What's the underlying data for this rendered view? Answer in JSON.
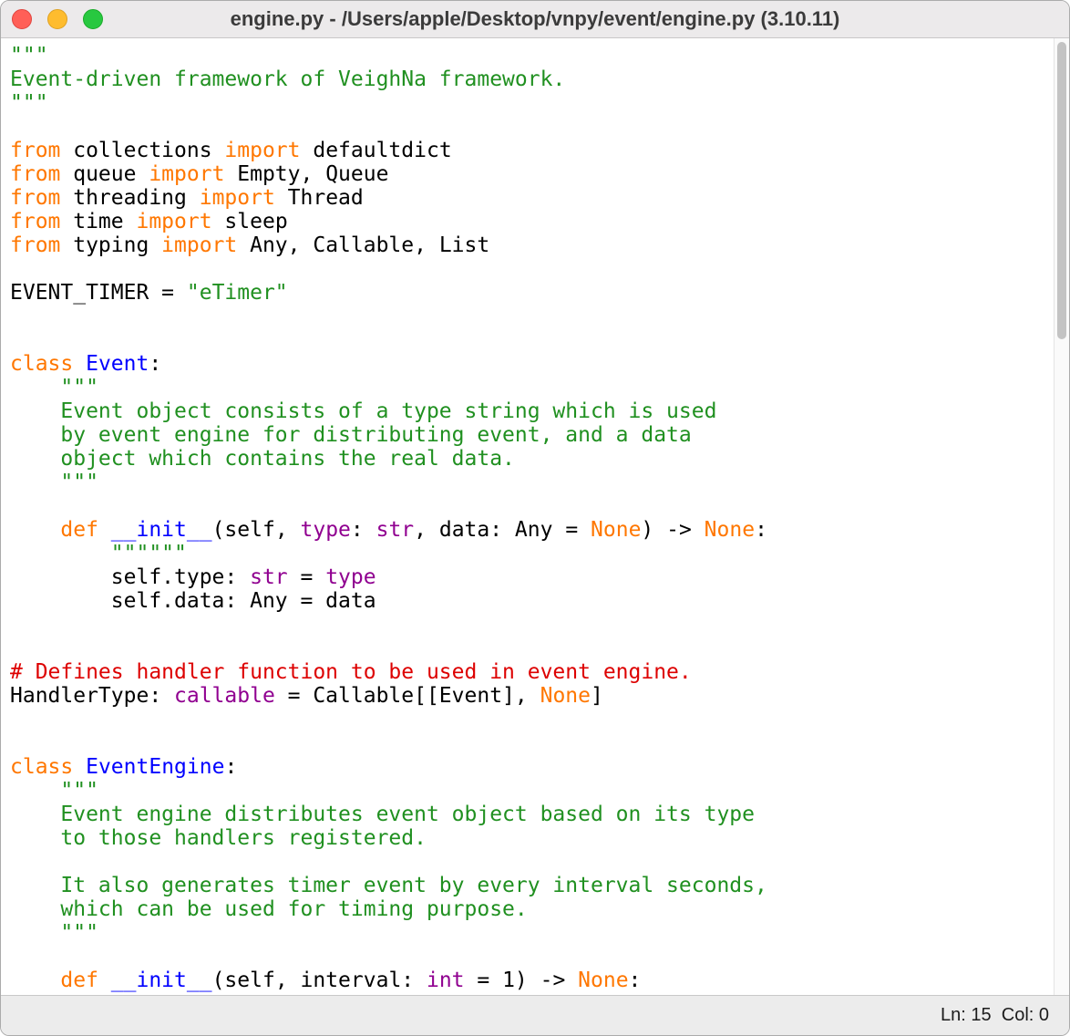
{
  "window": {
    "title": "engine.py - /Users/apple/Desktop/vnpy/event/engine.py (3.10.11)",
    "traffic_lights": [
      "close",
      "minimize",
      "zoom"
    ]
  },
  "status_bar": {
    "line_col": "Ln: 15  Col: 0"
  },
  "colors": {
    "keyword": "#ff7700",
    "string": "#209020",
    "comment": "#dd0000",
    "definition": "#0000ff",
    "builtin": "#900090",
    "plain": "#000000",
    "close_button": "#ff5f57",
    "minimize_button": "#febc2e",
    "zoom_button": "#28c840",
    "titlebar_bg": "#eceaeb",
    "statusbar_bg": "#ececec"
  },
  "code": {
    "language": "python",
    "lines": [
      [
        {
          "t": "\"\"\"",
          "c": "str"
        }
      ],
      [
        {
          "t": "Event-driven framework of VeighNa framework.",
          "c": "str"
        }
      ],
      [
        {
          "t": "\"\"\"",
          "c": "str"
        }
      ],
      [],
      [
        {
          "t": "from",
          "c": "kw"
        },
        {
          "t": " collections ",
          "c": "pl"
        },
        {
          "t": "import",
          "c": "kw"
        },
        {
          "t": " defaultdict",
          "c": "pl"
        }
      ],
      [
        {
          "t": "from",
          "c": "kw"
        },
        {
          "t": " queue ",
          "c": "pl"
        },
        {
          "t": "import",
          "c": "kw"
        },
        {
          "t": " Empty, Queue",
          "c": "pl"
        }
      ],
      [
        {
          "t": "from",
          "c": "kw"
        },
        {
          "t": " threading ",
          "c": "pl"
        },
        {
          "t": "import",
          "c": "kw"
        },
        {
          "t": " Thread",
          "c": "pl"
        }
      ],
      [
        {
          "t": "from",
          "c": "kw"
        },
        {
          "t": " time ",
          "c": "pl"
        },
        {
          "t": "import",
          "c": "kw"
        },
        {
          "t": " sleep",
          "c": "pl"
        }
      ],
      [
        {
          "t": "from",
          "c": "kw"
        },
        {
          "t": " typing ",
          "c": "pl"
        },
        {
          "t": "import",
          "c": "kw"
        },
        {
          "t": " Any, Callable, List",
          "c": "pl"
        }
      ],
      [],
      [
        {
          "t": "EVENT_TIMER = ",
          "c": "pl"
        },
        {
          "t": "\"eTimer\"",
          "c": "str"
        }
      ],
      [],
      [],
      [
        {
          "t": "class",
          "c": "kw"
        },
        {
          "t": " ",
          "c": "pl"
        },
        {
          "t": "Event",
          "c": "def"
        },
        {
          "t": ":",
          "c": "pl"
        }
      ],
      [
        {
          "t": "    ",
          "c": "pl"
        },
        {
          "t": "\"\"\"",
          "c": "str"
        }
      ],
      [
        {
          "t": "    ",
          "c": "pl"
        },
        {
          "t": "Event object consists of a type string which is used",
          "c": "str"
        }
      ],
      [
        {
          "t": "    ",
          "c": "pl"
        },
        {
          "t": "by event engine for distributing event, and a data",
          "c": "str"
        }
      ],
      [
        {
          "t": "    ",
          "c": "pl"
        },
        {
          "t": "object which contains the real data.",
          "c": "str"
        }
      ],
      [
        {
          "t": "    ",
          "c": "pl"
        },
        {
          "t": "\"\"\"",
          "c": "str"
        }
      ],
      [],
      [
        {
          "t": "    ",
          "c": "pl"
        },
        {
          "t": "def",
          "c": "kw"
        },
        {
          "t": " ",
          "c": "pl"
        },
        {
          "t": "__init__",
          "c": "def"
        },
        {
          "t": "(self, ",
          "c": "pl"
        },
        {
          "t": "type",
          "c": "bi"
        },
        {
          "t": ": ",
          "c": "pl"
        },
        {
          "t": "str",
          "c": "bi"
        },
        {
          "t": ", data: Any = ",
          "c": "pl"
        },
        {
          "t": "None",
          "c": "kw"
        },
        {
          "t": ") -> ",
          "c": "pl"
        },
        {
          "t": "None",
          "c": "kw"
        },
        {
          "t": ":",
          "c": "pl"
        }
      ],
      [
        {
          "t": "        ",
          "c": "pl"
        },
        {
          "t": "\"\"\"\"\"\"",
          "c": "str"
        }
      ],
      [
        {
          "t": "        self.type: ",
          "c": "pl"
        },
        {
          "t": "str",
          "c": "bi"
        },
        {
          "t": " = ",
          "c": "pl"
        },
        {
          "t": "type",
          "c": "bi"
        }
      ],
      [
        {
          "t": "        self.data: Any = data",
          "c": "pl"
        }
      ],
      [],
      [],
      [
        {
          "t": "# Defines handler function to be used in event engine.",
          "c": "com"
        }
      ],
      [
        {
          "t": "HandlerType: ",
          "c": "pl"
        },
        {
          "t": "callable",
          "c": "bi"
        },
        {
          "t": " = Callable[[Event], ",
          "c": "pl"
        },
        {
          "t": "None",
          "c": "kw"
        },
        {
          "t": "]",
          "c": "pl"
        }
      ],
      [],
      [],
      [
        {
          "t": "class",
          "c": "kw"
        },
        {
          "t": " ",
          "c": "pl"
        },
        {
          "t": "EventEngine",
          "c": "def"
        },
        {
          "t": ":",
          "c": "pl"
        }
      ],
      [
        {
          "t": "    ",
          "c": "pl"
        },
        {
          "t": "\"\"\"",
          "c": "str"
        }
      ],
      [
        {
          "t": "    ",
          "c": "pl"
        },
        {
          "t": "Event engine distributes event object based on its type",
          "c": "str"
        }
      ],
      [
        {
          "t": "    ",
          "c": "pl"
        },
        {
          "t": "to those handlers registered.",
          "c": "str"
        }
      ],
      [],
      [
        {
          "t": "    ",
          "c": "pl"
        },
        {
          "t": "It also generates timer event by every interval seconds,",
          "c": "str"
        }
      ],
      [
        {
          "t": "    ",
          "c": "pl"
        },
        {
          "t": "which can be used for timing purpose.",
          "c": "str"
        }
      ],
      [
        {
          "t": "    ",
          "c": "pl"
        },
        {
          "t": "\"\"\"",
          "c": "str"
        }
      ],
      [],
      [
        {
          "t": "    ",
          "c": "pl"
        },
        {
          "t": "def",
          "c": "kw"
        },
        {
          "t": " ",
          "c": "pl"
        },
        {
          "t": "__init__",
          "c": "def"
        },
        {
          "t": "(self, interval: ",
          "c": "pl"
        },
        {
          "t": "int",
          "c": "bi"
        },
        {
          "t": " = 1) -> ",
          "c": "pl"
        },
        {
          "t": "None",
          "c": "kw"
        },
        {
          "t": ":",
          "c": "pl"
        }
      ]
    ]
  }
}
